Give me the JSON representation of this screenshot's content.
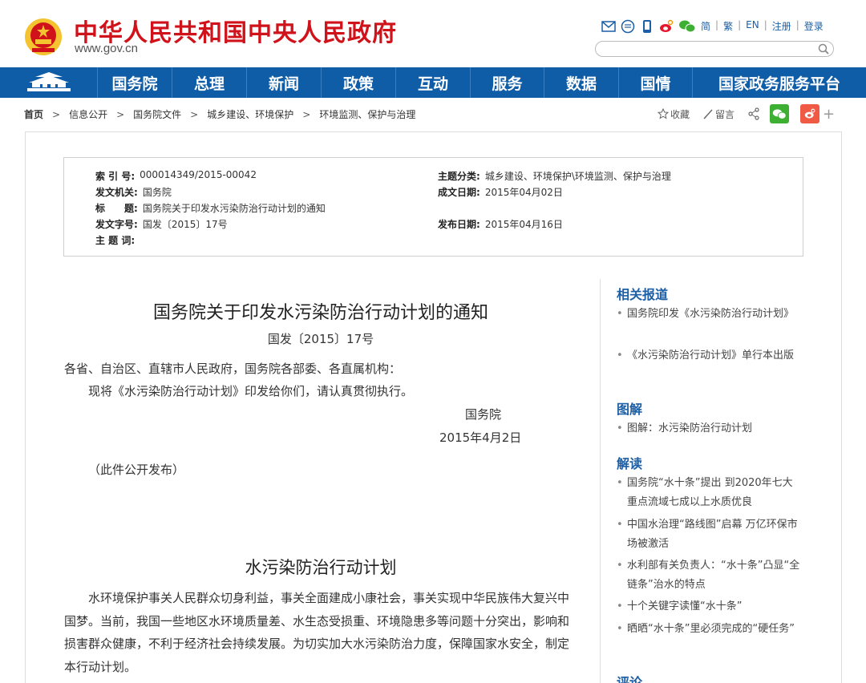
{
  "header": {
    "site_title": "中华人民共和国中央人民政府",
    "site_url": "www.gov.cn",
    "top_links": [
      "简",
      "繁",
      "EN",
      "注册",
      "登录"
    ],
    "icons": [
      "mail-icon",
      "chat-icon",
      "mobile-icon",
      "weibo-icon",
      "wechat-icon"
    ],
    "search_placeholder": ""
  },
  "nav": {
    "items": [
      "国务院",
      "总理",
      "新闻",
      "政策",
      "互动",
      "服务",
      "数据",
      "国情",
      "国家政务服务平台"
    ]
  },
  "breadcrumb": {
    "items": [
      "首页",
      "信息公开",
      "国务院文件",
      "城乡建设、环境保护",
      "环境监测、保护与治理"
    ]
  },
  "tools": {
    "favorite": "收藏",
    "comment": "留言"
  },
  "meta": {
    "index_label": "索 引 号:",
    "index_value": "000014349/2015-00042",
    "topic_label": "主题分类:",
    "topic_value": "城乡建设、环境保护\\环境监测、保护与治理",
    "issuer_label": "发文机关:",
    "issuer_value": "国务院",
    "written_label": "成文日期:",
    "written_value": "2015年04月02日",
    "title_label": "标　　题:",
    "title_value": "国务院关于印发水污染防治行动计划的通知",
    "docno_label": "发文字号:",
    "docno_value": "国发〔2015〕17号",
    "published_label": "发布日期:",
    "published_value": "2015年04月16日",
    "keywords_label": "主 题 词:"
  },
  "article": {
    "title": "国务院关于印发水污染防治行动计划的通知",
    "doc_no": "国发〔2015〕17号",
    "salutation": "各省、自治区、直辖市人民政府，国务院各部委、各直属机构：",
    "body": "现将《水污染防治行动计划》印发给你们，请认真贯彻执行。",
    "signer": "国务院",
    "date": "2015年4月2日",
    "note": "（此件公开发布）",
    "plan_title": "水污染防治行动计划",
    "intro": "水环境保护事关人民群众切身利益，事关全面建成小康社会，事关实现中华民族伟大复兴中国梦。当前，我国一些地区水环境质量差、水生态受损重、环境隐患多等问题十分突出，影响和损害群众健康，不利于经济社会持续发展。为切实加大水污染防治力度，保障国家水安全，制定本行动计划。"
  },
  "sidebar": {
    "related_head": "相关报道",
    "related": [
      "国务院印发《水污染防治行动计划》",
      "《水污染防治行动计划》单行本出版"
    ],
    "graphic_head": "图解",
    "graphic": [
      "图解：水污染防治行动计划"
    ],
    "interpret_head": "解读",
    "interpret": [
      "国务院“水十条”提出 到2020年七大重点流域七成以上水质优良",
      "中国水治理“路线图”启幕 万亿环保市场被激活",
      "水利部有关负责人：“水十条”凸显“全链条”治水的特点",
      "十个关键字读懂“水十条”",
      "晒晒“水十条”里必须完成的“硬任务”"
    ],
    "comment_head": "评论"
  },
  "colors": {
    "brand_red": "#d0121b",
    "nav_blue": "#0f5ca7",
    "link_blue": "#1c5fa6"
  }
}
